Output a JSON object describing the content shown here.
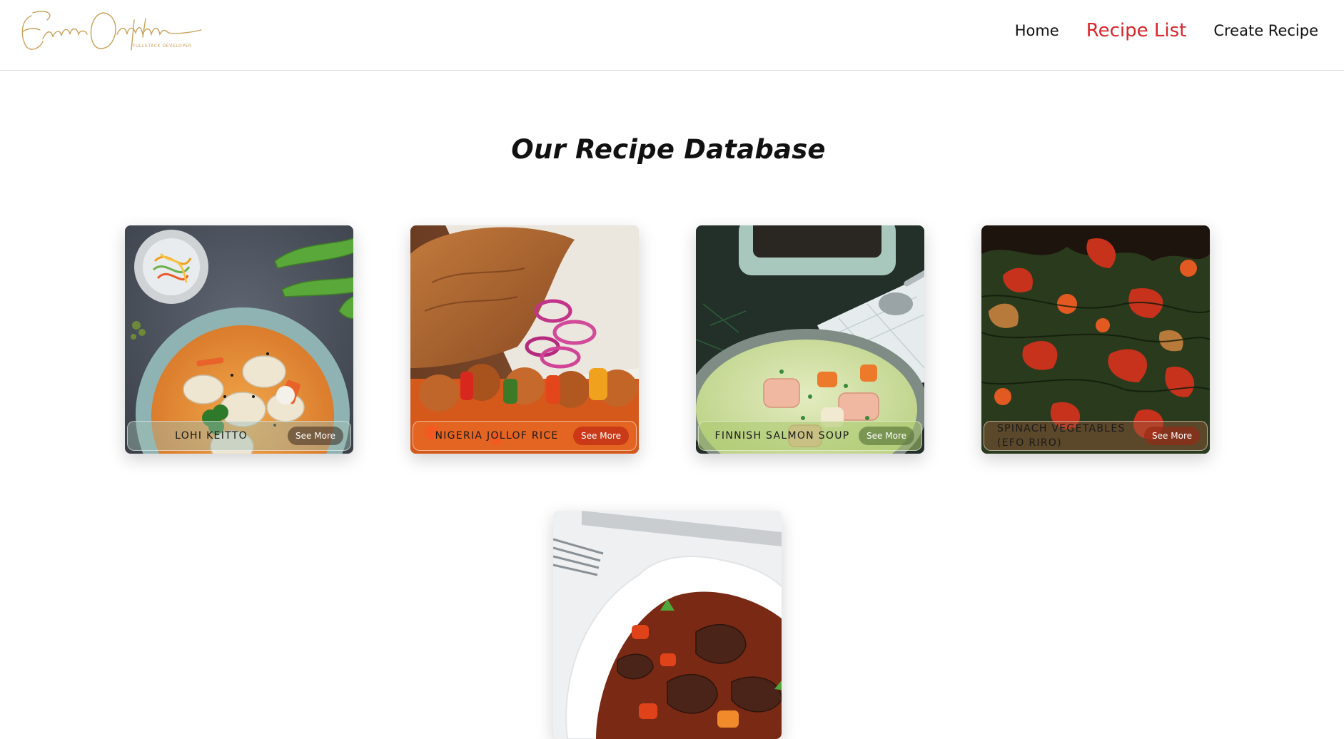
{
  "brand": {
    "logo_script": "EnitanOdupitan",
    "logo_tagline": "FULLSTACK DEVELOPER",
    "logo_color": "#c9a25a"
  },
  "nav": {
    "items": [
      {
        "label": "Home",
        "active": false
      },
      {
        "label": "Recipe List",
        "active": true
      },
      {
        "label": "Create Recipe",
        "active": false
      }
    ],
    "active_color": "#d8262c"
  },
  "page": {
    "title": "Our Recipe Database"
  },
  "recipes": [
    {
      "name": "LOHI KEITTO",
      "button": "See More"
    },
    {
      "name": "NIGERIA JOLLOF RICE",
      "button": "See More"
    },
    {
      "name": "FINNISH SALMON SOUP",
      "button": "See More"
    },
    {
      "name": "SPINACH VEGETABLES (EFO RIRO)",
      "button": "See More"
    },
    {
      "name": "",
      "button": ""
    }
  ]
}
